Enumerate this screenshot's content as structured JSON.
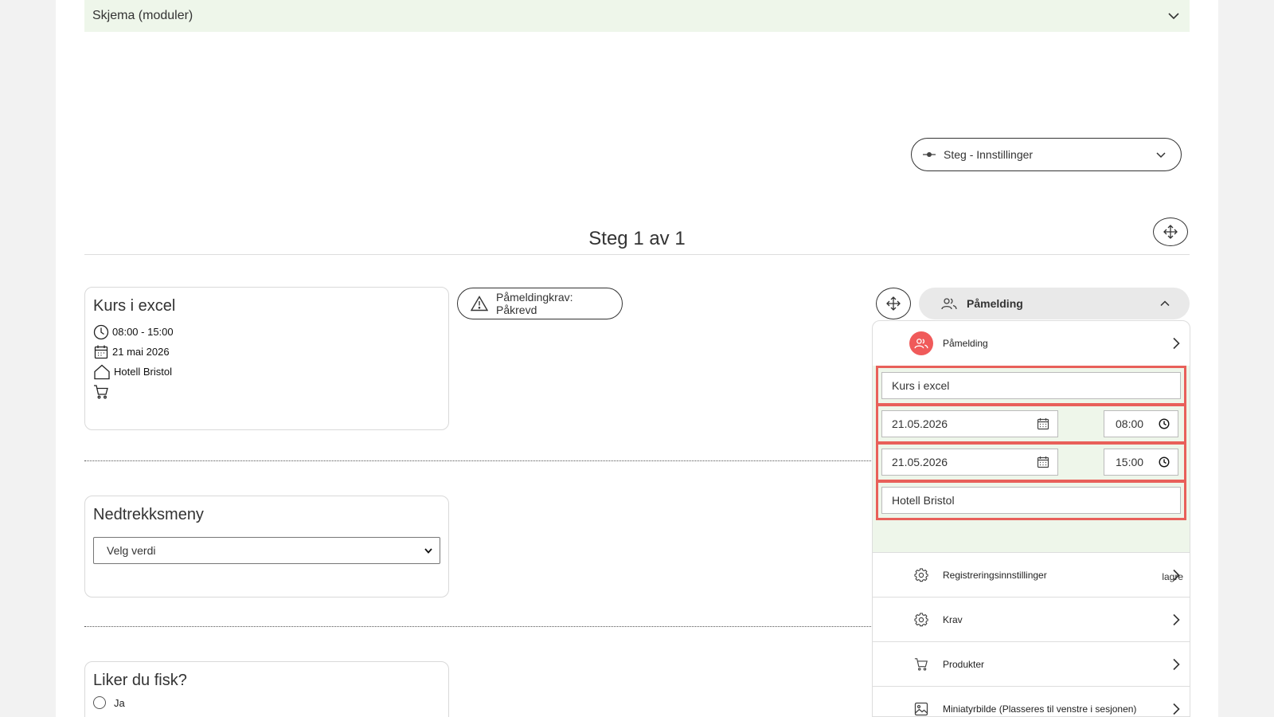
{
  "schema": {
    "title": "Skjema (moduler)"
  },
  "step_settings": {
    "label": "Steg - Innstillinger"
  },
  "step": {
    "title": "Steg 1 av 1"
  },
  "event_card": {
    "title": "Kurs i excel",
    "time": "08:00 - 15:00",
    "date": "21 mai 2026",
    "location": "Hotell Bristol"
  },
  "requirement_pill": {
    "label": "Påmeldingkrav: Påkrevd"
  },
  "dropdown_card": {
    "title": "Nedtrekksmeny",
    "select_value": "Velg verdi"
  },
  "fish_card": {
    "title": "Liker du fisk?",
    "option_1": "Ja"
  },
  "registration_panel": {
    "header": "Påmelding",
    "top_item": "Påmelding",
    "name_value": "Kurs i excel",
    "start_date": "21.05.2026",
    "start_time": "08:00",
    "end_date": "21.05.2026",
    "end_time": "15:00",
    "location_value": "Hotell Bristol",
    "save_label": "lagre",
    "items": [
      {
        "label": "Registreringsinnstillinger",
        "icon": "gear-icon"
      },
      {
        "label": "Krav",
        "icon": "gear-icon"
      },
      {
        "label": "Produkter",
        "icon": "cart-icon"
      },
      {
        "label": "Miniatyrbilde (Plasseres til venstre i sesjonen)",
        "icon": "image-icon"
      }
    ]
  },
  "colors": {
    "highlight": "#e8605a",
    "green_bg": "#eef6ea",
    "avatar": "#f05a5a"
  }
}
